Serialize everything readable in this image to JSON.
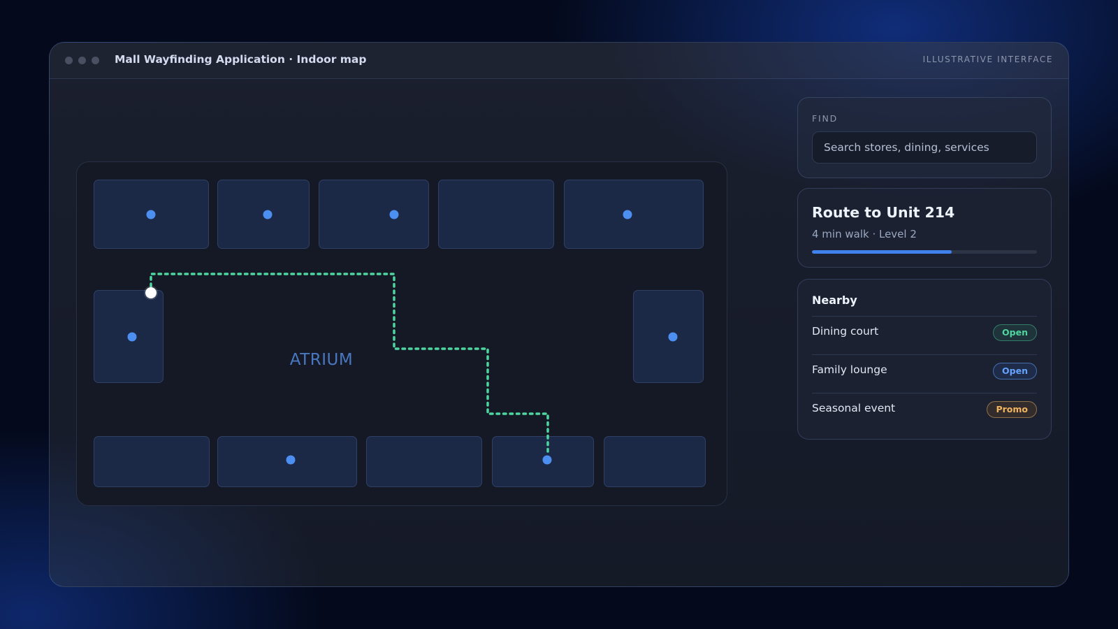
{
  "window": {
    "title": "Mall Wayfinding Application · Indoor map",
    "tag": "ILLUSTRATIVE INTERFACE"
  },
  "map": {
    "atrium_label": "ATRIUM"
  },
  "find": {
    "label": "FIND",
    "placeholder": "Search stores, dining, services"
  },
  "route": {
    "title": "Route to Unit 214",
    "subtitle": "4 min walk · Level 2",
    "progress": 0.62,
    "accent_color": "#3f82ee",
    "path_color": "#4fd6a0"
  },
  "nearby": {
    "title": "Nearby",
    "items": [
      {
        "name": "Dining court",
        "badge": "Open",
        "tone": "green"
      },
      {
        "name": "Family lounge",
        "badge": "Open",
        "tone": "blue"
      },
      {
        "name": "Seasonal event",
        "badge": "Promo",
        "tone": "amber"
      }
    ]
  }
}
